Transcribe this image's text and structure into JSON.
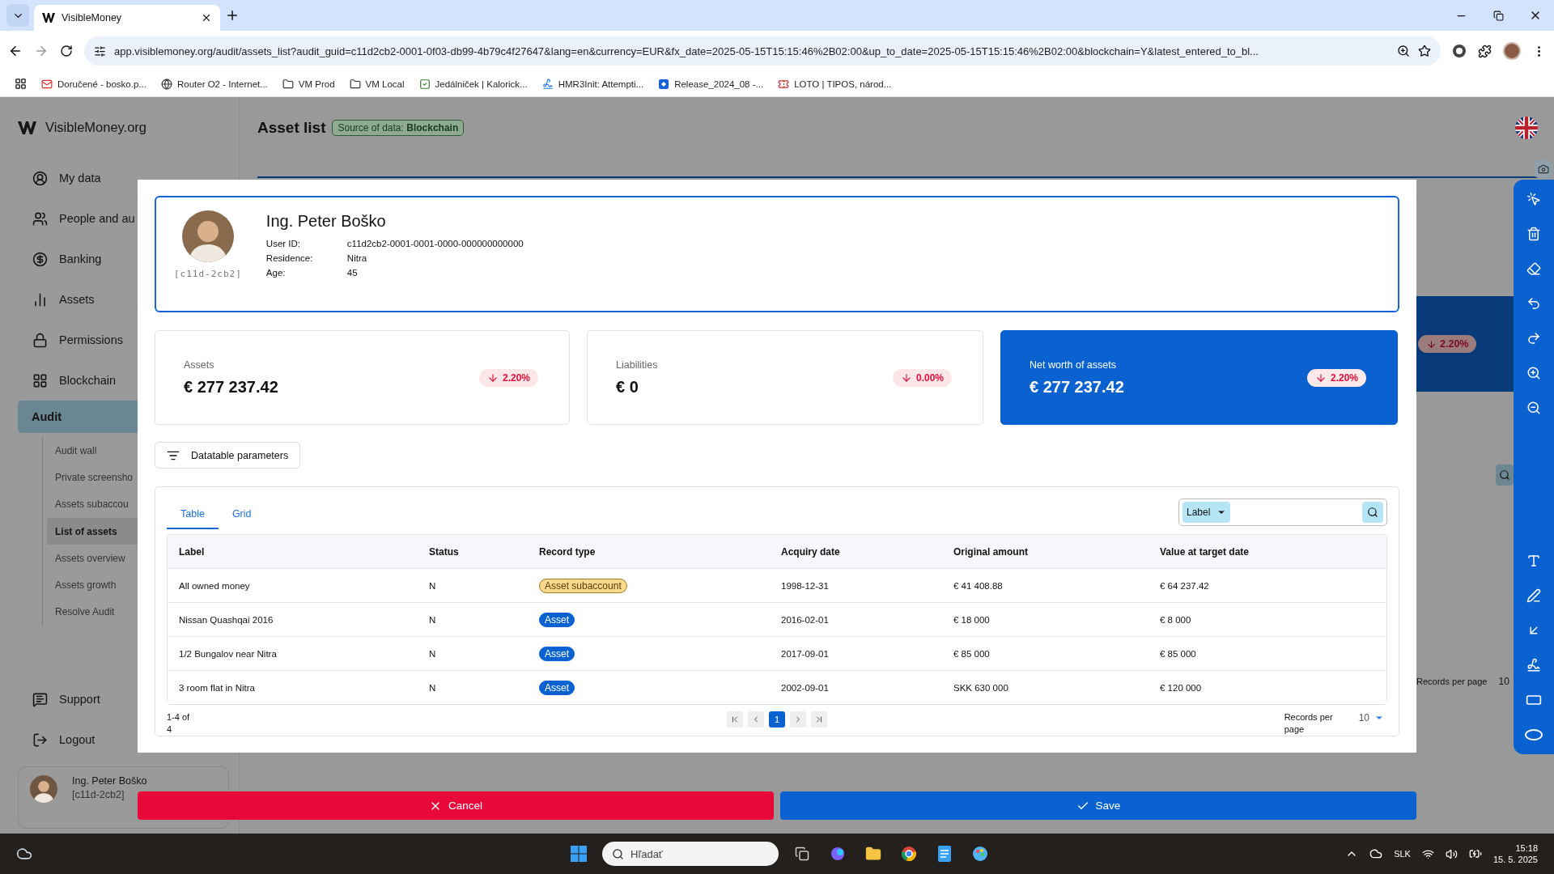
{
  "browser": {
    "tab_title": "VisibleMoney",
    "url": "app.visiblemoney.org/audit/assets_list?audit_guid=c11d2cb2-0001-0f03-db99-4b79c4f27647&lang=en&currency=EUR&fx_date=2025-05-15T15:15:46%2B02:00&up_to_date=2025-05-15T15:15:46%2B02:00&blockchain=Y&latest_entered_to_bl...",
    "bookmarks": [
      {
        "label": "Doručené - bosko.p...",
        "kind": "mail"
      },
      {
        "label": "Router O2 - Internet...",
        "kind": "globe"
      },
      {
        "label": "VM Prod",
        "kind": "folder"
      },
      {
        "label": "VM Local",
        "kind": "folder"
      },
      {
        "label": "Jedálniček | Kalorick...",
        "kind": "check"
      },
      {
        "label": "HMR3Init: Attempti...",
        "kind": "v"
      },
      {
        "label": "Release_2024_08 -...",
        "kind": "jira"
      },
      {
        "label": "LOTO | TIPOS, národ...",
        "kind": "loto"
      }
    ]
  },
  "sidebar": {
    "brand": "VisibleMoney.org",
    "items": [
      {
        "label": "My data",
        "kind": "user",
        "selected": false
      },
      {
        "label": "People and au",
        "kind": "people",
        "selected": false
      },
      {
        "label": "Banking",
        "kind": "bank",
        "selected": false
      },
      {
        "label": "Assets",
        "kind": "chart",
        "selected": false
      },
      {
        "label": "Permissions",
        "kind": "lock",
        "selected": false
      },
      {
        "label": "Blockchain",
        "kind": "grid",
        "selected": false
      },
      {
        "label": "Audit",
        "selected": true,
        "children": [
          {
            "label": "Audit wall",
            "selected": false
          },
          {
            "label": "Private screensho",
            "selected": false
          },
          {
            "label": "Assets subaccou",
            "selected": false
          },
          {
            "label": "List of assets",
            "selected": true
          },
          {
            "label": "Assets overview",
            "selected": false
          },
          {
            "label": "Assets growth",
            "selected": false
          },
          {
            "label": "Resolve Audit",
            "selected": false
          }
        ]
      }
    ],
    "bottom_items": [
      {
        "label": "Support",
        "kind": "support"
      },
      {
        "label": "Logout",
        "kind": "logout"
      }
    ],
    "user": {
      "name": "Ing. Peter Boško",
      "tag": "[c11d-2cb2]"
    }
  },
  "page": {
    "title": "Asset list",
    "source_badge": "Source of data: **Blockchain**",
    "background_badge": "2.20%",
    "background_records_label": "Records per page",
    "background_records_value": "10"
  },
  "modal": {
    "profile": {
      "name": "Ing. Peter Boško",
      "tag": "[c11d-2cb2]",
      "fields": [
        {
          "label": "User ID:",
          "value": "c11d2cb2-0001-0001-0000-000000000000"
        },
        {
          "label": "Residence:",
          "value": "Nitra"
        },
        {
          "label": "Age:",
          "value": "45"
        }
      ]
    },
    "stats": [
      {
        "label": "Assets",
        "value": "€ 277 237.42",
        "change": "2.20%",
        "highlighted": false
      },
      {
        "label": "Liabilities",
        "value": "€ 0",
        "change": "0.00%",
        "highlighted": false
      },
      {
        "label": "Net worth of assets",
        "value": "€ 277 237.42",
        "change": "2.20%",
        "highlighted": true
      }
    ],
    "params_button": "Datatable parameters",
    "tabs": [
      {
        "label": "Table",
        "selected": true
      },
      {
        "label": "Grid",
        "selected": false
      }
    ],
    "search_filter": "Label",
    "columns": [
      "Label",
      "Status",
      "Record type",
      "Acquiry date",
      "Original amount",
      "Value at target date"
    ],
    "rows": [
      {
        "label": "All owned money",
        "status": "N",
        "record_type": "Asset subaccount",
        "kind": "subaccount",
        "date": "1998-12-31",
        "original": "€ 41 408.88",
        "value": "€ 64 237.42"
      },
      {
        "label": "Nissan Quashqai 2016",
        "status": "N",
        "record_type": "Asset",
        "kind": "asset",
        "date": "2016-02-01",
        "original": "€ 18 000",
        "value": "€ 8 000"
      },
      {
        "label": "1/2 Bungalov near Nitra",
        "status": "N",
        "record_type": "Asset",
        "kind": "asset",
        "date": "2017-09-01",
        "original": "€ 85 000",
        "value": "€ 85 000"
      },
      {
        "label": "3 room flat in Nitra",
        "status": "N",
        "record_type": "Asset",
        "kind": "asset",
        "date": "2002-09-01",
        "original": "SKK 630 000",
        "value": "€ 120 000"
      }
    ],
    "range": "1-4 of 4",
    "pages": [
      {
        "label": "1",
        "selected": true
      }
    ],
    "records_label": "Records per page",
    "records_value": "10",
    "cancel": "Cancel",
    "save": "Save"
  },
  "taskbar": {
    "search_placeholder": "Hľadať",
    "language": "SLK",
    "time": "15:18",
    "date": "15. 5. 2025"
  }
}
